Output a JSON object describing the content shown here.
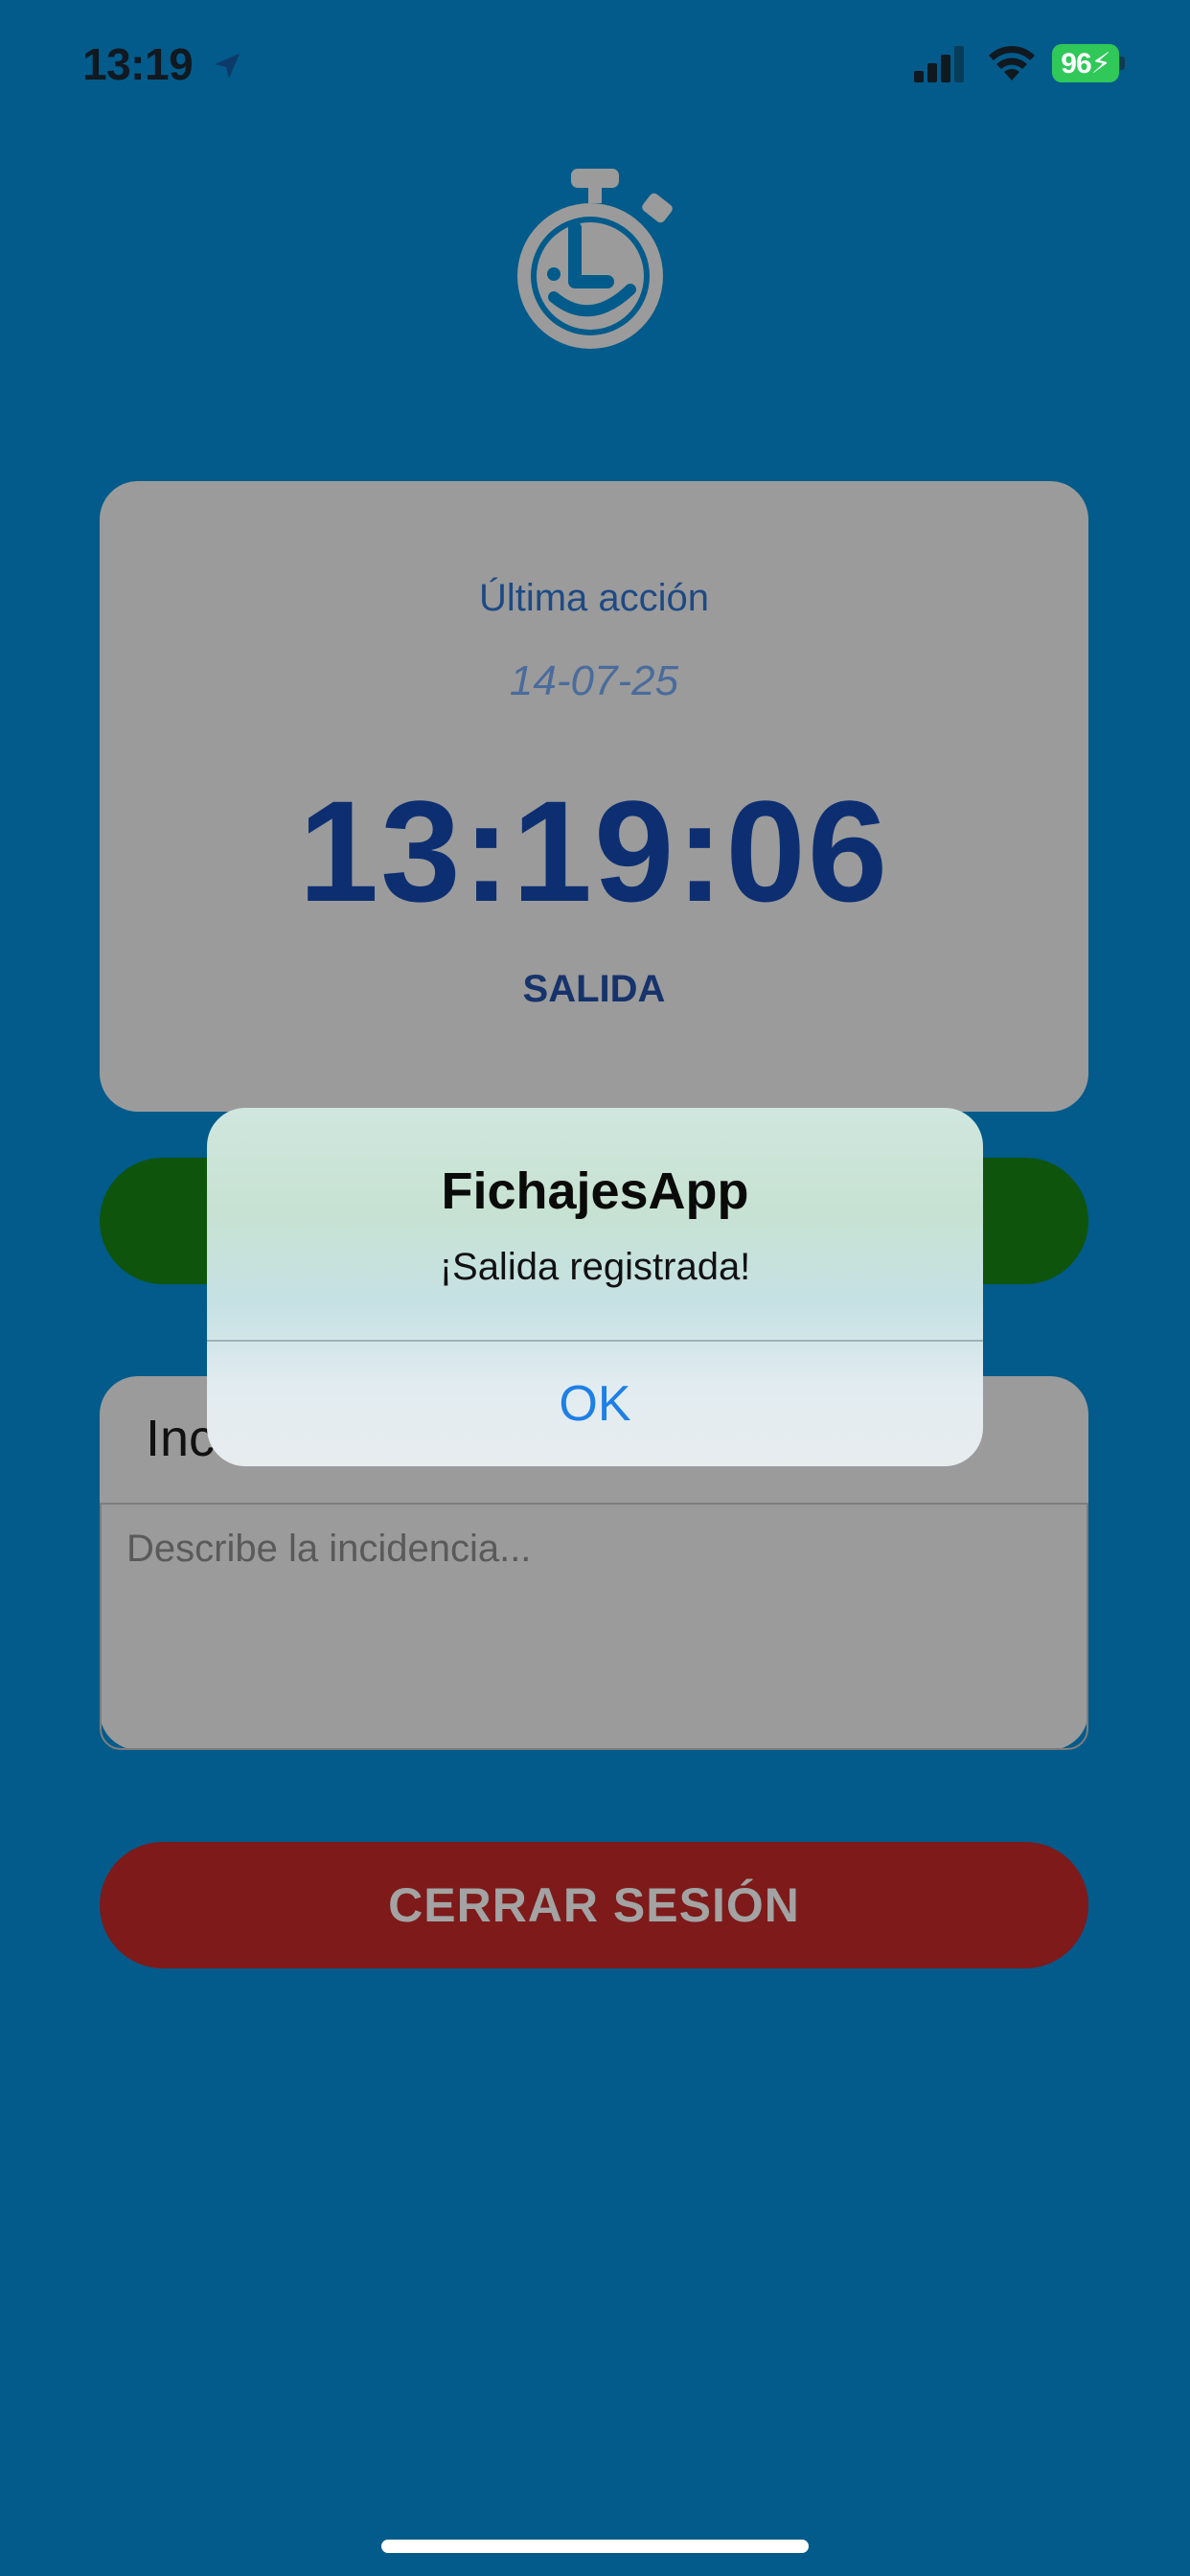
{
  "status_bar": {
    "time": "13:19",
    "battery": "96"
  },
  "last_action": {
    "label": "Última acción",
    "date": "14-07-25",
    "time": "13:19:06",
    "type": "SALIDA"
  },
  "incidence": {
    "title_visible": "Inc",
    "placeholder": "Describe la incidencia..."
  },
  "logout_label": "CERRAR SESIÓN",
  "alert": {
    "title": "FichajesApp",
    "message": "¡Salida registrada!",
    "ok_label": "OK"
  },
  "colors": {
    "background": "#025B8A",
    "card": "#9B9B9B",
    "clock_text": "#0D2F72",
    "check_button": "#0F540C",
    "logout_button": "#7E1A1A",
    "alert_action": "#1E7FE6"
  }
}
